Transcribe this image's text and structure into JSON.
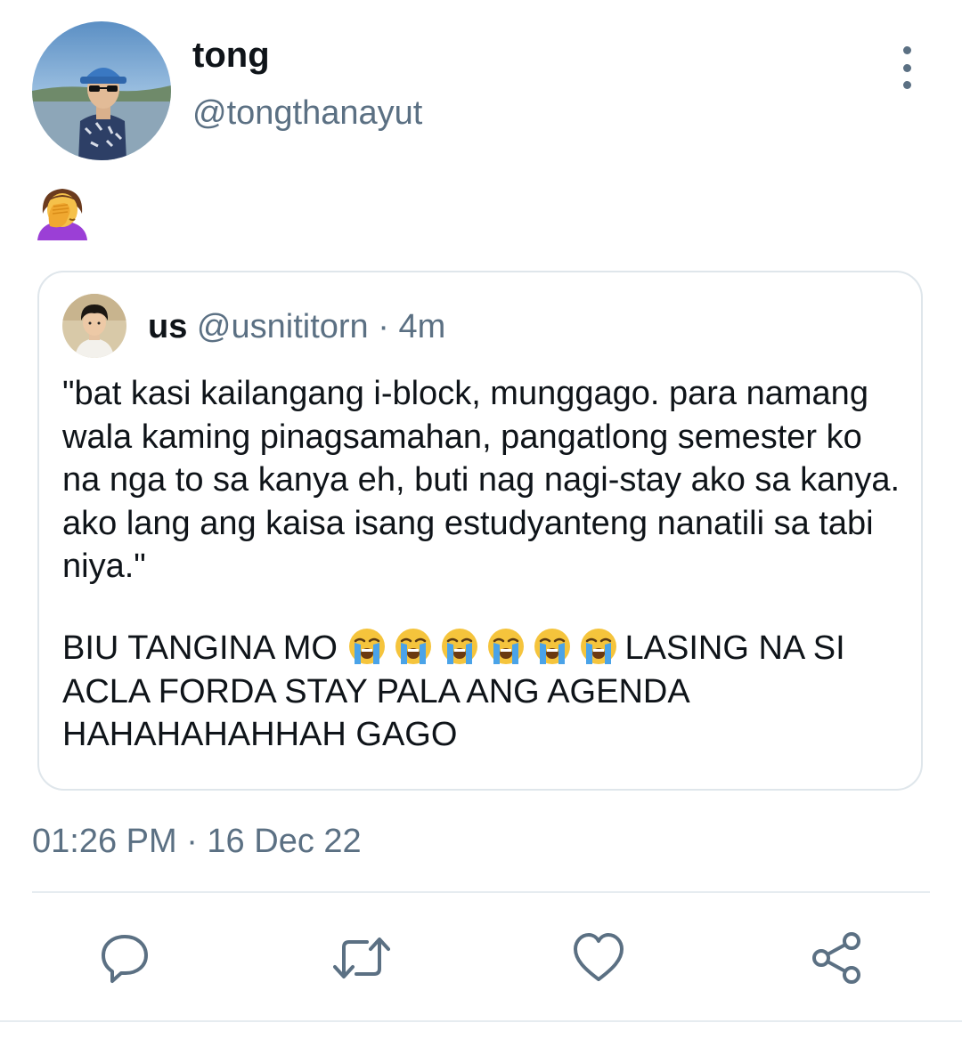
{
  "tweet": {
    "author": {
      "display_name": "tong",
      "handle": "@tongthanayut"
    },
    "emoji_icon": "woman-facepalming-emoji",
    "timestamp": "01:26 PM · 16 Dec 22"
  },
  "quoted_tweet": {
    "display_name": "us",
    "handle": "@usnititorn",
    "age": "· 4m",
    "body_paragraph_1": "\"bat kasi kailangang i-block, munggago. para namang wala kaming pinagsamahan, pangatlong semester ko na nga to sa kanya eh, buti nag nagi-stay ako sa kanya. ako lang ang kaisa isang estudyanteng nanatili sa tabi niya.\"",
    "body_paragraph_2_prefix": "BIU TANGINA MO",
    "crying_emoji_count": 6,
    "body_paragraph_2_suffix": "LASING NA SI ACLA FORDA STAY PALA ANG AGENDA HAHAHAHAHHAH GAGO"
  },
  "actions": [
    {
      "icon": "reply-icon"
    },
    {
      "icon": "retweet-icon"
    },
    {
      "icon": "like-icon"
    },
    {
      "icon": "share-icon"
    }
  ],
  "colors": {
    "text_primary": "#0f1419",
    "text_secondary": "#5b7083",
    "border": "#dfe6eb"
  }
}
